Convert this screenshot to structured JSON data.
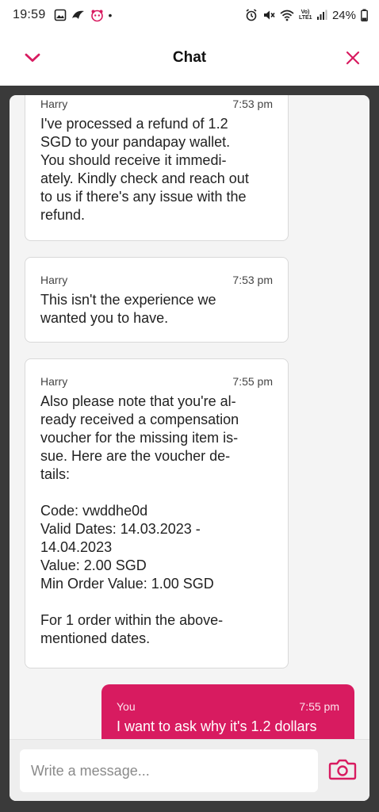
{
  "status_bar": {
    "time": "19:59",
    "dot": "•",
    "battery": "24%",
    "network": "Vo) LTE1"
  },
  "header": {
    "title": "Chat",
    "collapse_icon": "chevron-down-icon",
    "close_icon": "close-icon",
    "accent_color": "#d81b60"
  },
  "messages": [
    {
      "sender": "Harry",
      "time": "7:53 pm",
      "text": "I've processed a refund of 1.2\nSGD to your pandapay wallet.\nYou should receive it immedi-\nately. Kindly check and reach out\nto us if there's any issue with the\nrefund."
    },
    {
      "sender": "Harry",
      "time": "7:53 pm",
      "text": "This isn't the experience we\nwanted you to have."
    },
    {
      "sender": "Harry",
      "time": "7:55 pm",
      "text": "Also please note that you're al-\nready received a compensation\nvoucher for the missing item is-\nsue. Here are the voucher de-\ntails:\n\nCode: vwddhe0d\nValid Dates: 14.03.2023 -\n14.04.2023\nValue: 2.00 SGD\nMin Order Value: 1.00 SGD\n\nFor 1 order within the above-\nmentioned dates."
    },
    {
      "sender": "You",
      "time": "7:55 pm",
      "text": "I want to ask why it's 1.2 dollars"
    }
  ],
  "composer": {
    "placeholder": "Write a message...",
    "value": "",
    "camera_icon": "camera-icon"
  }
}
